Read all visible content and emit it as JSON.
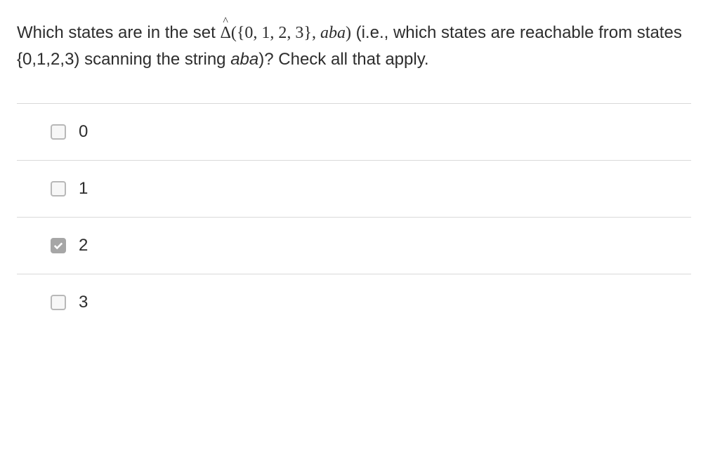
{
  "question": {
    "prefix": "Which states are in the set ",
    "delta": "Δ",
    "hat": "^",
    "args": "({0, 1, 2, 3}, ",
    "string_arg": "aba",
    "args_close": ")",
    "middle": " (i.e., which states are reachable from states {0,1,2,3) scanning the string ",
    "string_ref": "aba",
    "suffix": ")? Check all that apply."
  },
  "options": [
    {
      "label": "0",
      "checked": false
    },
    {
      "label": "1",
      "checked": false
    },
    {
      "label": "2",
      "checked": true
    },
    {
      "label": "3",
      "checked": false
    }
  ]
}
